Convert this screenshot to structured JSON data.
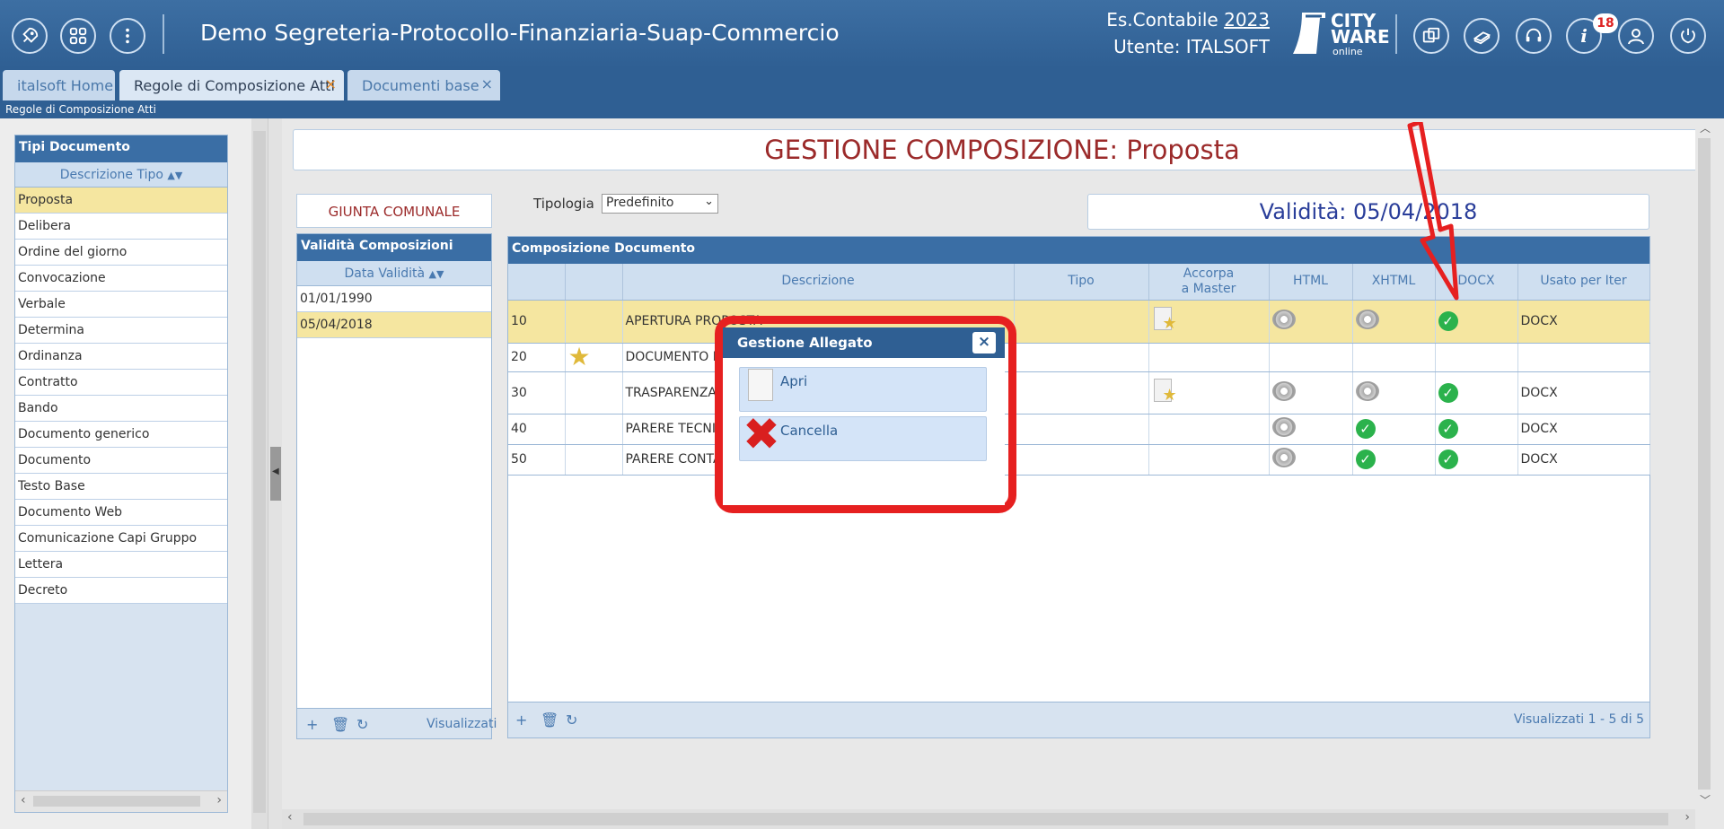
{
  "header": {
    "app_title": "Demo Segreteria-Protocollo-Finanziaria-Suap-Commercio",
    "es_label": "Es.Contabile",
    "es_year": "2023",
    "user_label": "Utente: ITALSOFT",
    "logo_line1": "CITY",
    "logo_line2": "WARE",
    "logo_line3": "online",
    "badge_count": "18",
    "icons": [
      "rocket-icon",
      "apps-grid-icon",
      "more-vertical-icon",
      "windows-icon",
      "book-icon",
      "headset-icon",
      "info-icon",
      "user-icon",
      "power-icon"
    ]
  },
  "tabs": [
    {
      "label": "italsoft Home"
    },
    {
      "label": "Regole di Composizione Atti"
    },
    {
      "label": "Documenti base"
    }
  ],
  "tab_close": "×",
  "breadcrumb": "Regole di Composizione Atti",
  "tipi_documento": {
    "title": "Tipi Documento",
    "column": "Descrizione Tipo",
    "items": [
      "Proposta",
      "Delibera",
      "Ordine del giorno",
      "Convocazione",
      "Verbale",
      "Determina",
      "Ordinanza",
      "Contratto",
      "Bando",
      "Documento generico",
      "Documento",
      "Testo Base",
      "Documento Web",
      "Comunicazione Capi Gruppo",
      "Lettera",
      "Decreto"
    ],
    "selected_index": 0
  },
  "main": {
    "title": "GESTIONE COMPOSIZIONE: Proposta",
    "giunta": "GIUNTA COMUNALE",
    "tipologia_label": "Tipologia",
    "tipologia_value": "Predefinito",
    "validita": "Validità: 05/04/2018"
  },
  "validita_composizioni": {
    "title": "Validità Composizioni",
    "column": "Data Validità",
    "rows": [
      "01/01/1990",
      "05/04/2018"
    ],
    "selected_index": 1,
    "footer_text": "Visualizzati"
  },
  "composizione": {
    "title": "Composizione Documento",
    "columns": [
      "",
      "",
      "Descrizione",
      "Tipo",
      "Accorpa a Master",
      "HTML",
      "XHTML",
      "DOCX",
      "Usato per Iter"
    ],
    "accorpa_line1": "Accorpa",
    "accorpa_line2": "a Master",
    "rows": [
      {
        "seq": "10",
        "descrizione": "APERTURA PROPOSTA",
        "usato": "DOCX"
      },
      {
        "seq": "20",
        "descrizione": "DOCUMENTO M",
        "usato": ""
      },
      {
        "seq": "30",
        "descrizione": "TRASPARENZA I",
        "usato": "DOCX"
      },
      {
        "seq": "40",
        "descrizione": "PARERE TECNIC",
        "usato": "DOCX"
      },
      {
        "seq": "50",
        "descrizione": "PARERE CONTA",
        "usato": "DOCX"
      }
    ],
    "footer_text": "Visualizzati 1 - 5 di 5"
  },
  "dialog": {
    "title": "Gestione Allegato",
    "close": "×",
    "apri": "Apri",
    "cancella": "Cancella"
  },
  "colors": {
    "header_blue": "#2f5f93",
    "title_red": "#9b2a2a",
    "highlight_yellow": "#f5e6a0",
    "annotation_red": "#e62020"
  }
}
